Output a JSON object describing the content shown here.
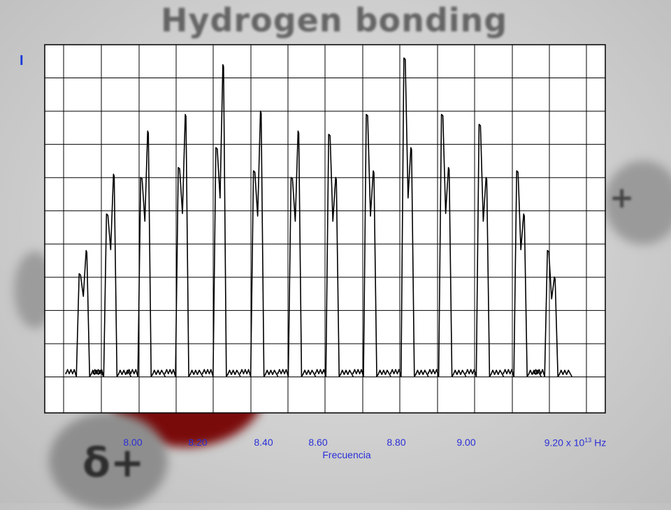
{
  "background": {
    "title_text": "Hydrogen bonding",
    "glyph_left": "δ+",
    "glyph_right": "+"
  },
  "chart_data": {
    "type": "line",
    "ylabel": "I",
    "xlabel": "Frecuencia",
    "x_ticks": [
      "8.00",
      "8.20",
      "8.40",
      "8.60",
      "8.80",
      "9.00",
      "9.20"
    ],
    "x_unit_prefix": "x 10",
    "x_unit_exp": "13",
    "x_unit_suffix": "Hz",
    "grid": true,
    "grid_columns": 15,
    "grid_rows": 10,
    "lines": [
      {
        "x": 7.87,
        "peak1": 0.31,
        "peak2": 0.38
      },
      {
        "x": 7.95,
        "peak1": 0.49,
        "peak2": 0.61
      },
      {
        "x": 8.05,
        "peak1": 0.6,
        "peak2": 0.74
      },
      {
        "x": 8.16,
        "peak1": 0.63,
        "peak2": 0.79
      },
      {
        "x": 8.27,
        "peak1": 0.69,
        "peak2": 0.94
      },
      {
        "x": 8.38,
        "peak1": 0.62,
        "peak2": 0.8
      },
      {
        "x": 8.49,
        "peak1": 0.6,
        "peak2": 0.74
      },
      {
        "x": 8.6,
        "peak1": 0.73,
        "peak2": 0.6
      },
      {
        "x": 8.71,
        "peak1": 0.79,
        "peak2": 0.62
      },
      {
        "x": 8.82,
        "peak1": 0.96,
        "peak2": 0.69
      },
      {
        "x": 8.93,
        "peak1": 0.79,
        "peak2": 0.63
      },
      {
        "x": 9.04,
        "peak1": 0.76,
        "peak2": 0.6
      },
      {
        "x": 9.15,
        "peak1": 0.62,
        "peak2": 0.49
      },
      {
        "x": 9.24,
        "peak1": 0.38,
        "peak2": 0.3
      }
    ]
  }
}
